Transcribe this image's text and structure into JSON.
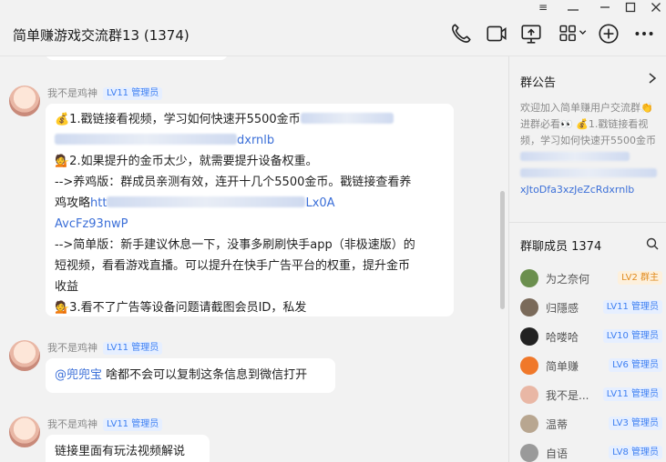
{
  "window": {
    "title": "简单赚游戏交流群13 (1374)"
  },
  "messages": [
    {
      "sender": "我不是鸡神",
      "badge": "LV11 管理员",
      "line1_prefix": "💰1.戳链接看视频，学习如何快速开5500金币",
      "line1_link_tail": "dxrnlb",
      "line2": "💁2.如果提升的金币太少，就需要提升设备权重。",
      "line3": "-->养鸡版：群成员亲测有效，连开十几个5500金币。戳链接查看养",
      "line4_prefix": "鸡攻略",
      "line4_link_head": "htt",
      "line4_link_tail": "Lx0A",
      "line5_link": "AvcFz93nwP",
      "line6": "-->简单版：新手建议休息一下，没事多刷刷快手app（非极速版）的",
      "line7": "短视频，看看游戏直播。可以提升在快手广告平台的权重，提升金币",
      "line8": "收益",
      "line9": "💁3.看不了广告等设备问题请截图会员ID，私发"
    },
    {
      "sender": "我不是鸡神",
      "badge": "LV11 管理员",
      "mention": "@兜兜宝",
      "text": " 啥都不会可以复制这条信息到微信打开"
    },
    {
      "sender": "我不是鸡神",
      "badge": "LV11 管理员",
      "text": "链接里面有玩法视频解说"
    }
  ],
  "side": {
    "notice_title": "群公告",
    "notice_text": "欢迎加入简单赚用户交流群👏 进群必看👀 💰1.戳链接看视频，学习如何快速开5500金币",
    "notice_link_tail": "xJtoDfa3xzJeZcRdxrnlb",
    "members_title": "群聊成员 1374",
    "members": [
      {
        "name": "为之奈何",
        "badge": "LV2 群主",
        "owner": true,
        "color": "#6b8f4e"
      },
      {
        "name": "归隱感",
        "badge": "LV11 管理员",
        "owner": false,
        "color": "#7a6a5a"
      },
      {
        "name": "哈喽哈",
        "badge": "LV10 管理员",
        "owner": false,
        "color": "#222222"
      },
      {
        "name": "简单赚",
        "badge": "LV6 管理员",
        "owner": false,
        "color": "#f0782a"
      },
      {
        "name": "我不是...",
        "badge": "LV11 管理员",
        "owner": false,
        "color": "#e9b7a5"
      },
      {
        "name": "温蒂",
        "badge": "LV3 管理员",
        "owner": false,
        "color": "#b8a690"
      },
      {
        "name": "自语",
        "badge": "LV8 管理员",
        "owner": false,
        "color": "#9a9a9a"
      }
    ]
  }
}
